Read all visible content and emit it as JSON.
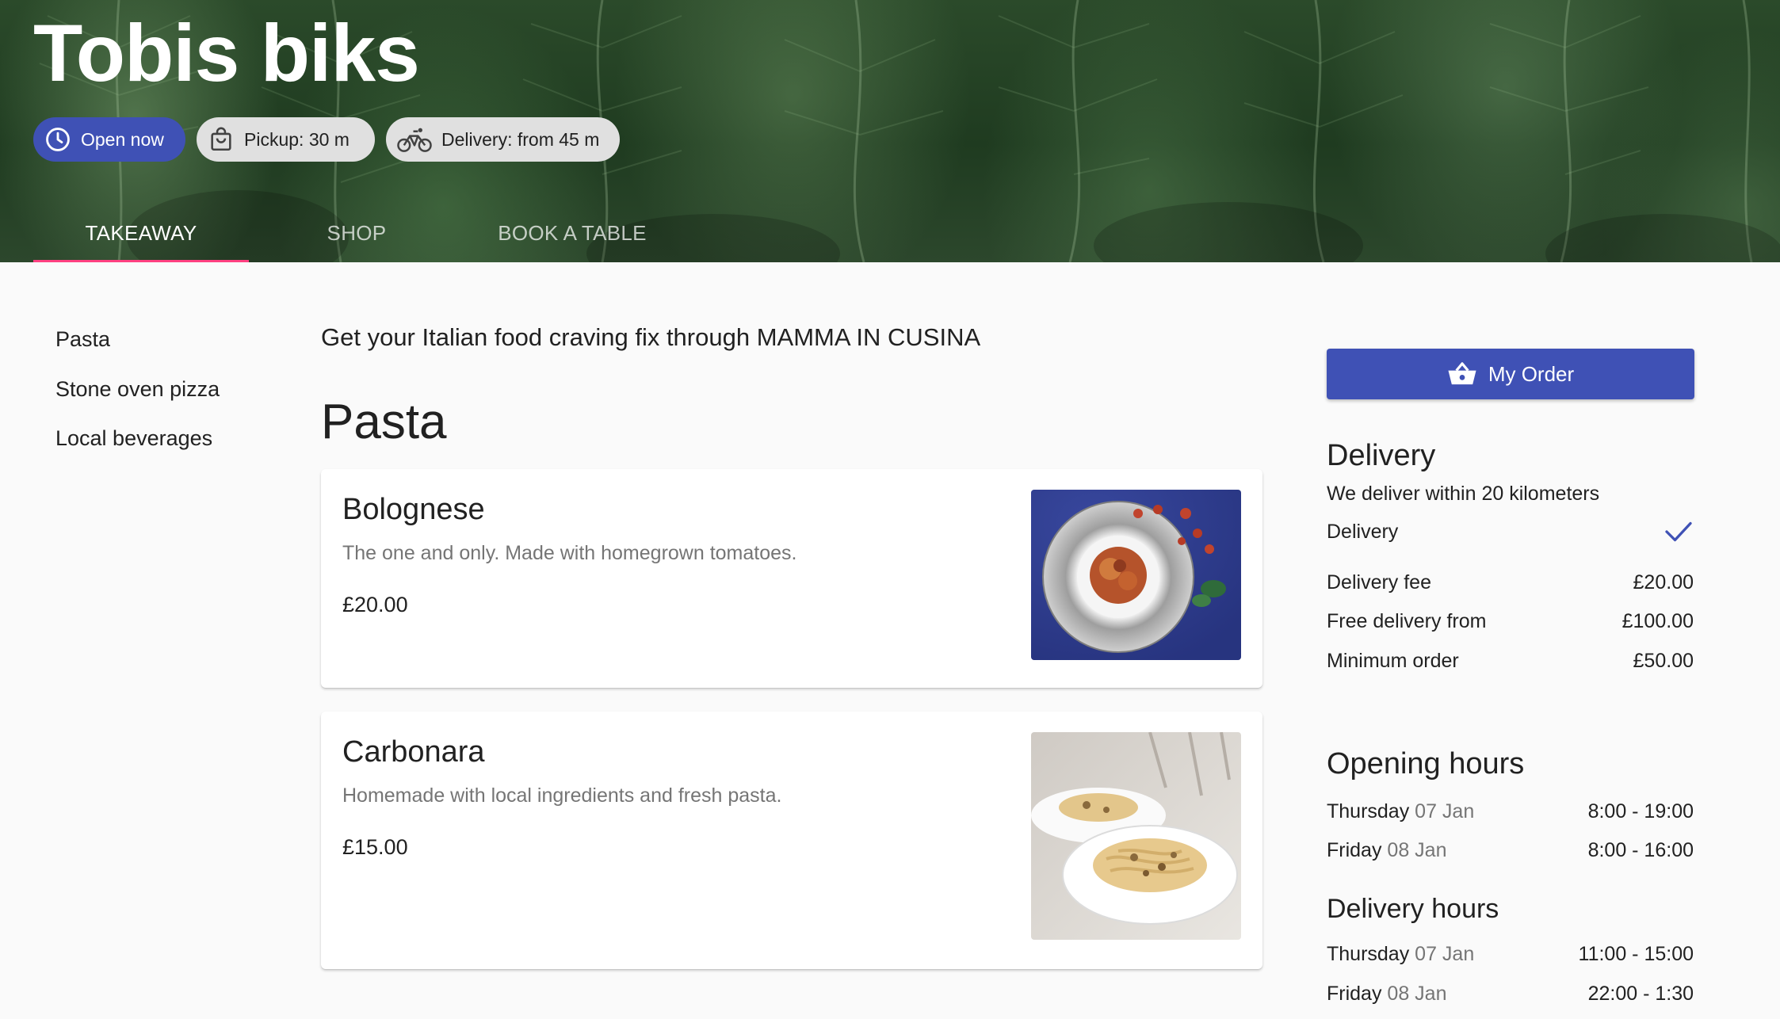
{
  "brand": "Tobis biks",
  "chips": {
    "open": "Open now",
    "pickup": "Pickup: 30 m",
    "delivery": "Delivery: from 45 m"
  },
  "tabs": [
    {
      "label": "TAKEAWAY",
      "active": true
    },
    {
      "label": "SHOP",
      "active": false
    },
    {
      "label": "BOOK A TABLE",
      "active": false
    }
  ],
  "sidebar": {
    "items": [
      {
        "label": "Pasta"
      },
      {
        "label": "Stone oven pizza"
      },
      {
        "label": "Local beverages"
      }
    ]
  },
  "main": {
    "intro": "Get your Italian food craving fix through MAMMA IN CUSINA",
    "section_title": "Pasta",
    "items": [
      {
        "name": "Bolognese",
        "description": "The one and only. Made with homegrown tomatoes.",
        "price": "£20.00"
      },
      {
        "name": "Carbonara",
        "description": "Homemade with local ingredients and fresh pasta.",
        "price": "£15.00"
      }
    ]
  },
  "order": {
    "button_label": "My Order"
  },
  "delivery": {
    "title": "Delivery",
    "subtitle": "We deliver within 20 kilometers",
    "option_label": "Delivery",
    "option_selected": true,
    "rows": [
      {
        "label": "Delivery fee",
        "value": "£20.00"
      },
      {
        "label": "Free delivery from",
        "value": "£100.00"
      },
      {
        "label": "Minimum order",
        "value": "£50.00"
      }
    ]
  },
  "opening_hours": {
    "title": "Opening hours",
    "rows": [
      {
        "day": "Thursday",
        "date": "07 Jan",
        "hours": "8:00 - 19:00"
      },
      {
        "day": "Friday",
        "date": "08 Jan",
        "hours": "8:00 - 16:00"
      }
    ]
  },
  "delivery_hours": {
    "title": "Delivery hours",
    "rows": [
      {
        "day": "Thursday",
        "date": "07 Jan",
        "hours": "11:00 - 15:00"
      },
      {
        "day": "Friday",
        "date": "08 Jan",
        "hours": "22:00 - 1:30"
      }
    ]
  },
  "colors": {
    "primary": "#3f51b5",
    "tab_indicator": "#ff4081",
    "chip_grey": "#e0e0e0",
    "hero_green": "#2b4a2a"
  },
  "icons": {
    "open": "clock-icon",
    "pickup": "shopping-bag-icon",
    "delivery": "bicycle-icon",
    "order": "basket-icon",
    "selected": "check-icon"
  }
}
